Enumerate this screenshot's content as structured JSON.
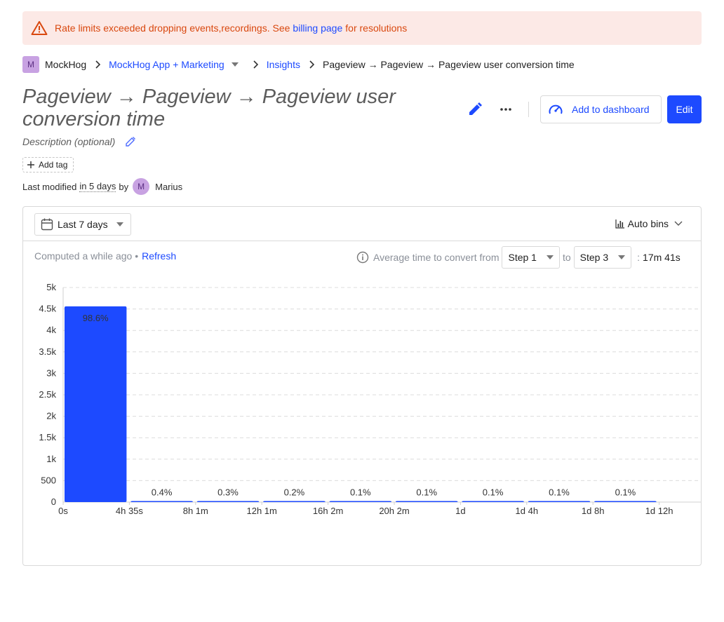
{
  "banner": {
    "text_before": "Rate limits exceeded dropping events,recordings. See",
    "link": "billing page",
    "text_after": "for resolutions",
    "icon": "warning-icon"
  },
  "breadcrumb": {
    "org_initial": "M",
    "org": "MockHog",
    "project": "MockHog App + Marketing",
    "section": "Insights",
    "current": "Pageview → Pageview → Pageview user conversion time"
  },
  "insight": {
    "title": "Pageview → Pageview → Pageview user conversion time",
    "description_placeholder": "Description (optional)",
    "add_tag": "Add tag",
    "add_to_dashboard": "Add to dashboard",
    "edit": "Edit"
  },
  "modified": {
    "prefix": "Last modified",
    "when": "in 5 days",
    "by": "by",
    "user_initial": "M",
    "user": "Marius"
  },
  "controls": {
    "date_range": "Last 7 days",
    "bins": "Auto bins",
    "computed": "Computed a while ago •",
    "refresh": "Refresh",
    "avg_label": "Average time to convert from",
    "from_step": "Step 1",
    "to": "to",
    "to_step": "Step 3",
    "colon": ":",
    "avg_value": "17m 41s"
  },
  "colors": {
    "accent": "#1d4aff",
    "banner_bg": "#fce9e6",
    "banner_text": "#d9480f"
  },
  "chart_data": {
    "type": "bar",
    "categories": [
      "0s",
      "4h 35s",
      "8h 1m",
      "12h 1m",
      "16h 2m",
      "20h 2m",
      "1d",
      "1d 4h",
      "1d 8h",
      "1d 12h"
    ],
    "x_tick_labels": [
      "0s",
      "4h 35s",
      "8h 1m",
      "12h 1m",
      "16h 2m",
      "20h 2m",
      "1d",
      "1d 4h",
      "1d 8h",
      "1d 12h"
    ],
    "values": [
      4560,
      18,
      14,
      9,
      5,
      5,
      5,
      5,
      5
    ],
    "data_labels": [
      "98.6%",
      "0.4%",
      "0.3%",
      "0.2%",
      "0.1%",
      "0.1%",
      "0.1%",
      "0.1%",
      "0.1%"
    ],
    "y_ticks": [
      "0",
      "500",
      "1k",
      "1.5k",
      "2k",
      "2.5k",
      "3k",
      "3.5k",
      "4k",
      "4.5k",
      "5k"
    ],
    "ylim": [
      0,
      5000
    ],
    "grid": true,
    "color": "#1d4aff"
  }
}
